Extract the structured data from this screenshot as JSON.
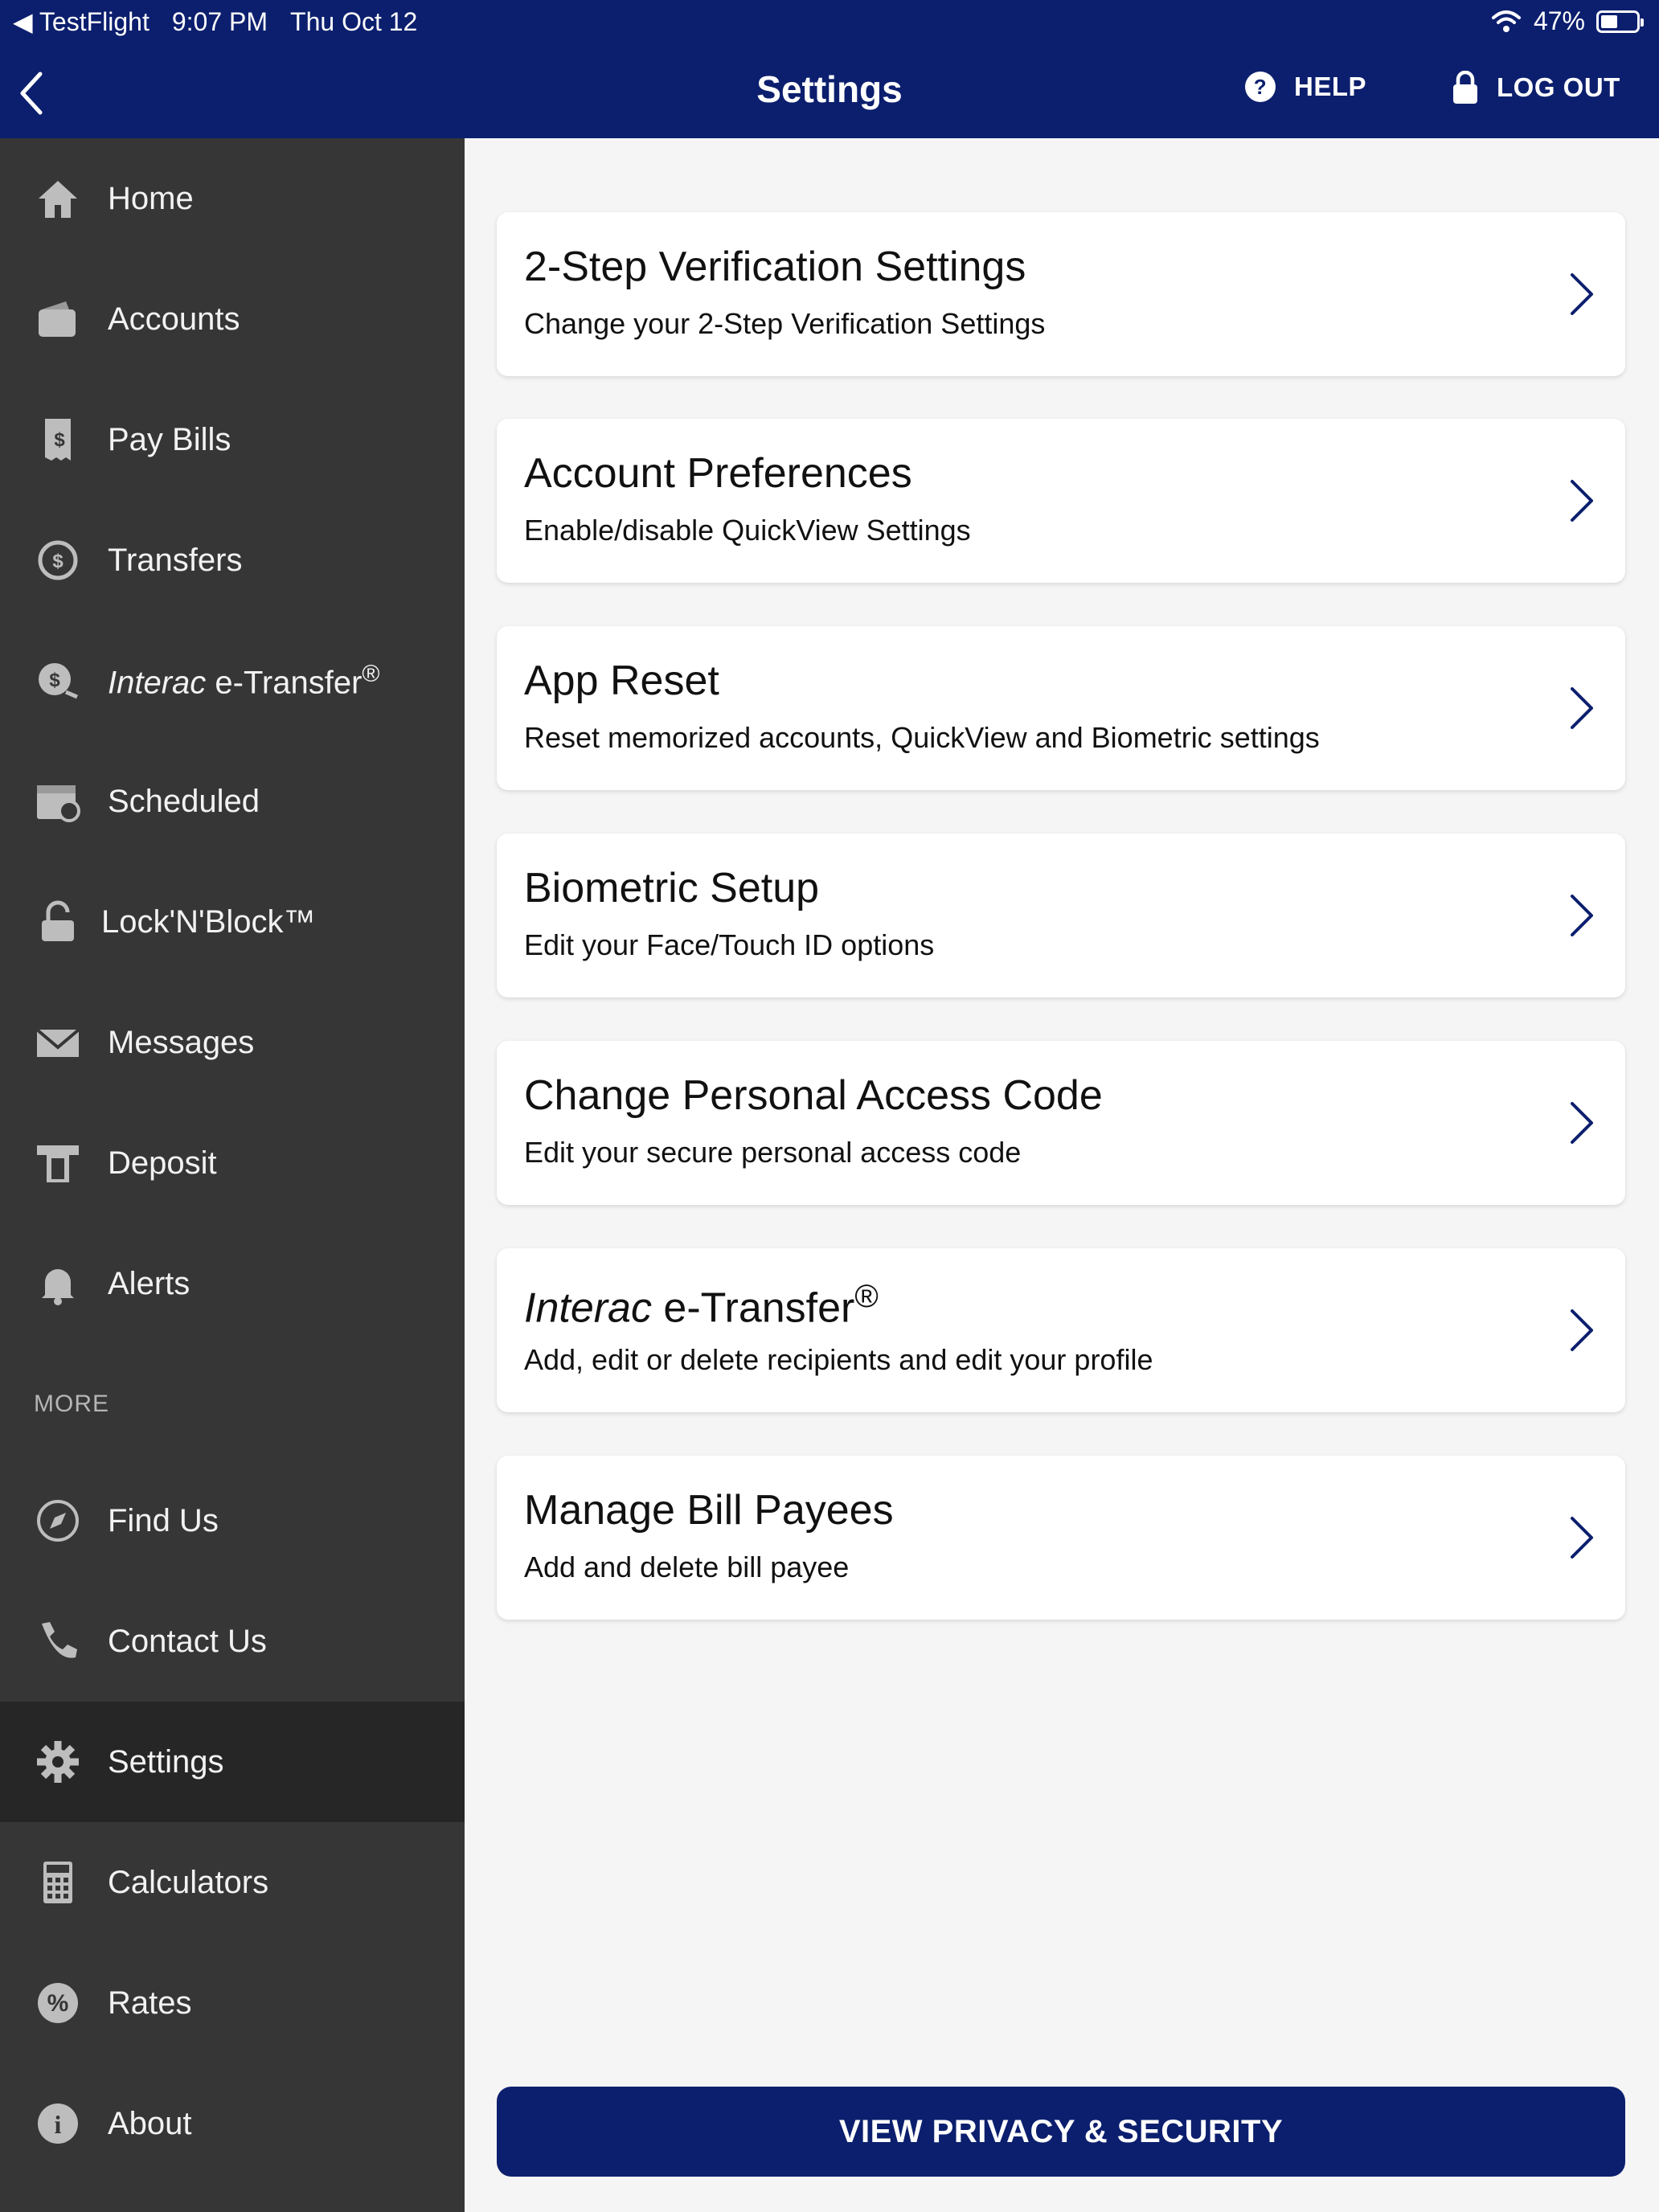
{
  "status": {
    "back_app": "◀ TestFlight",
    "time": "9:07 PM",
    "date": "Thu Oct 12",
    "battery": "47%"
  },
  "header": {
    "title": "Settings",
    "help_label": "HELP",
    "logout_label": "LOG OUT"
  },
  "sidebar": {
    "items": [
      {
        "label": "Home",
        "icon": "home-icon"
      },
      {
        "label": "Accounts",
        "icon": "wallet-icon"
      },
      {
        "label": "Pay Bills",
        "icon": "bill-icon"
      },
      {
        "label": "Transfers",
        "icon": "transfer-icon"
      },
      {
        "label_italic": "Interac",
        "label_rest": " e-Transfer",
        "label_sup": "®",
        "icon": "etransfer-icon"
      },
      {
        "label": "Scheduled",
        "icon": "calendar-icon"
      },
      {
        "label": "Lock'N'Block™",
        "icon": "lock-icon"
      },
      {
        "label": "Messages",
        "icon": "envelope-icon"
      },
      {
        "label": "Deposit",
        "icon": "deposit-icon"
      },
      {
        "label": "Alerts",
        "icon": "bell-icon"
      }
    ],
    "more_label": "MORE",
    "more_items": [
      {
        "label": "Find Us",
        "icon": "compass-icon"
      },
      {
        "label": "Contact Us",
        "icon": "phone-icon"
      },
      {
        "label": "Settings",
        "icon": "gear-icon",
        "active": true
      },
      {
        "label": "Calculators",
        "icon": "calculator-icon"
      },
      {
        "label": "Rates",
        "icon": "percent-icon"
      },
      {
        "label": "About",
        "icon": "info-icon"
      }
    ]
  },
  "settings": [
    {
      "title": "2-Step Verification Settings",
      "subtitle": "Change your 2-Step Verification Settings"
    },
    {
      "title": "Account Preferences",
      "subtitle": "Enable/disable QuickView Settings"
    },
    {
      "title": "App Reset",
      "subtitle": "Reset memorized accounts, QuickView and Biometric settings"
    },
    {
      "title": "Biometric Setup",
      "subtitle": "Edit your Face/Touch ID options"
    },
    {
      "title": "Change Personal Access Code",
      "subtitle": "Edit your secure personal access code"
    },
    {
      "title_italic": "Interac",
      "title_rest": " e-Transfer",
      "title_sup": "®",
      "subtitle": "Add, edit or delete recipients and edit your profile"
    },
    {
      "title": "Manage Bill Payees",
      "subtitle": "Add and delete bill payee"
    }
  ],
  "privacy_button": "VIEW PRIVACY & SECURITY",
  "colors": {
    "nav": "#0c1f6e",
    "sidebar": "#363636",
    "sidebar_active": "#262626",
    "background": "#f5f5f5"
  }
}
